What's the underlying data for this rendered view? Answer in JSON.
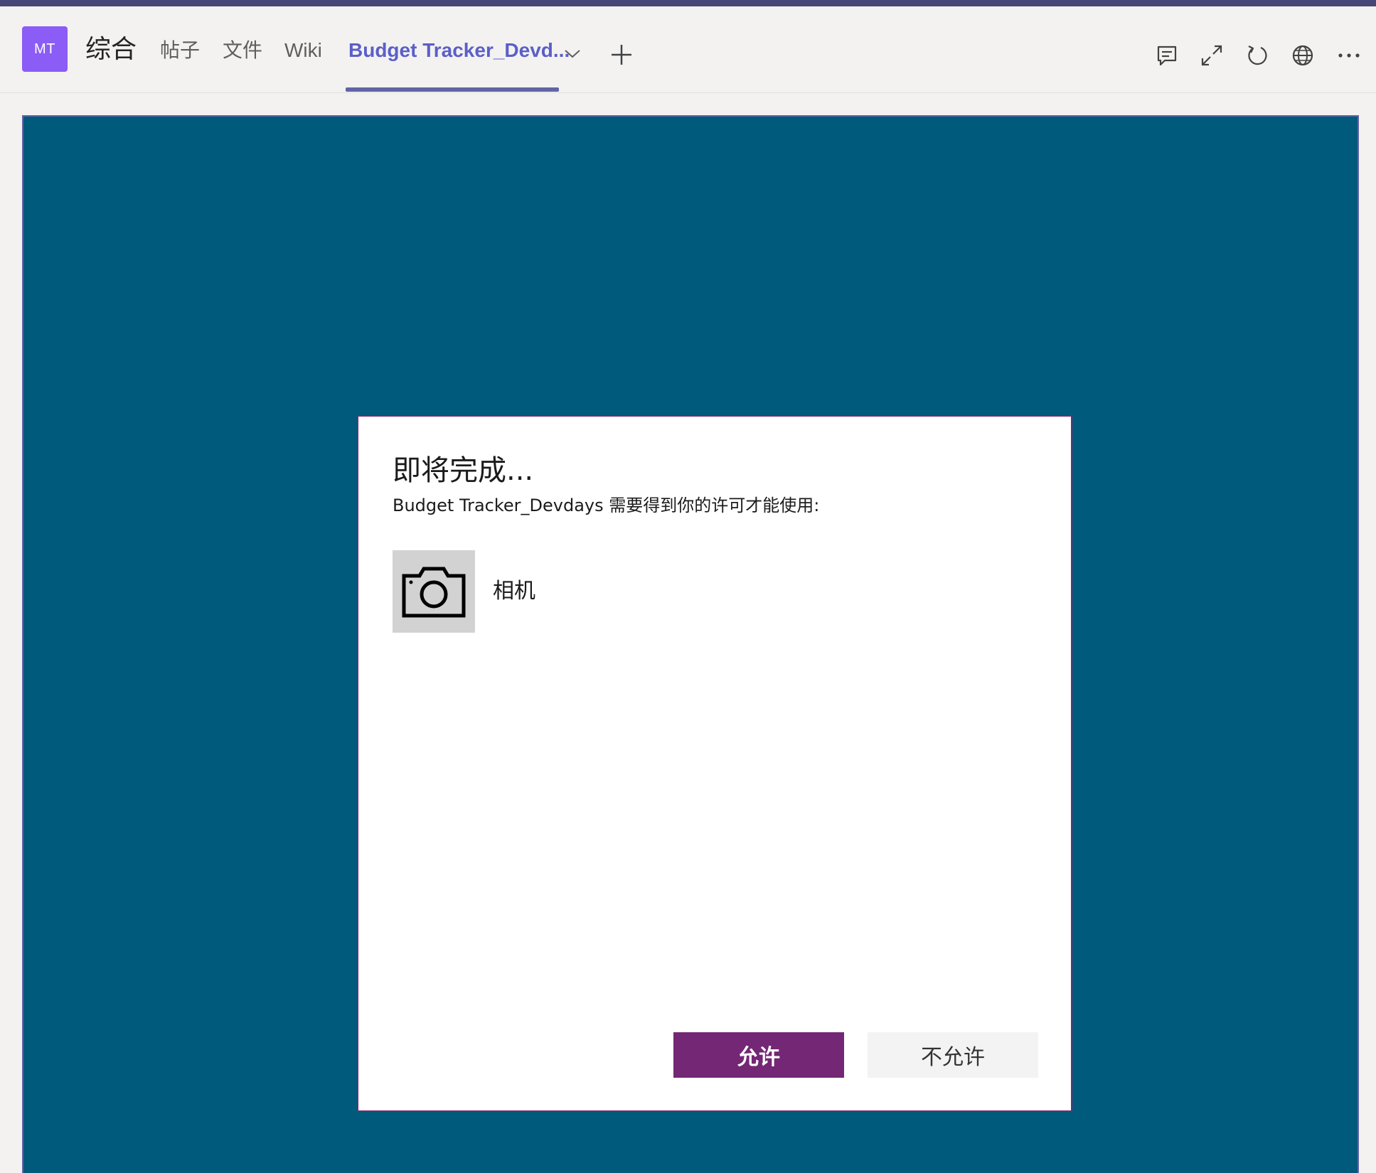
{
  "header": {
    "avatar_initials": "MT",
    "channel_name": "综合",
    "tabs": [
      {
        "label": "帖子"
      },
      {
        "label": "文件"
      },
      {
        "label": "Wiki"
      },
      {
        "label": "Budget Tracker_Devd..."
      }
    ],
    "active_tab_index": 3,
    "icons": [
      "chevron-down-icon",
      "add-tab-icon",
      "conversation-icon",
      "expand-icon",
      "refresh-icon",
      "globe-icon",
      "more-options-icon"
    ]
  },
  "dialog": {
    "title": "即将完成...",
    "subtitle": "Budget Tracker_Devdays 需要得到你的许可才能使用:",
    "permission": {
      "icon": "camera-icon",
      "label": "相机"
    },
    "allow_label": "允许",
    "deny_label": "不允许"
  },
  "colors": {
    "accent": "#6264a7",
    "top_stripe": "#464775",
    "avatar_bg": "#8b5cf6",
    "content_bg": "#005a7b",
    "allow_button": "#742774",
    "deny_button": "#f3f3f3"
  }
}
